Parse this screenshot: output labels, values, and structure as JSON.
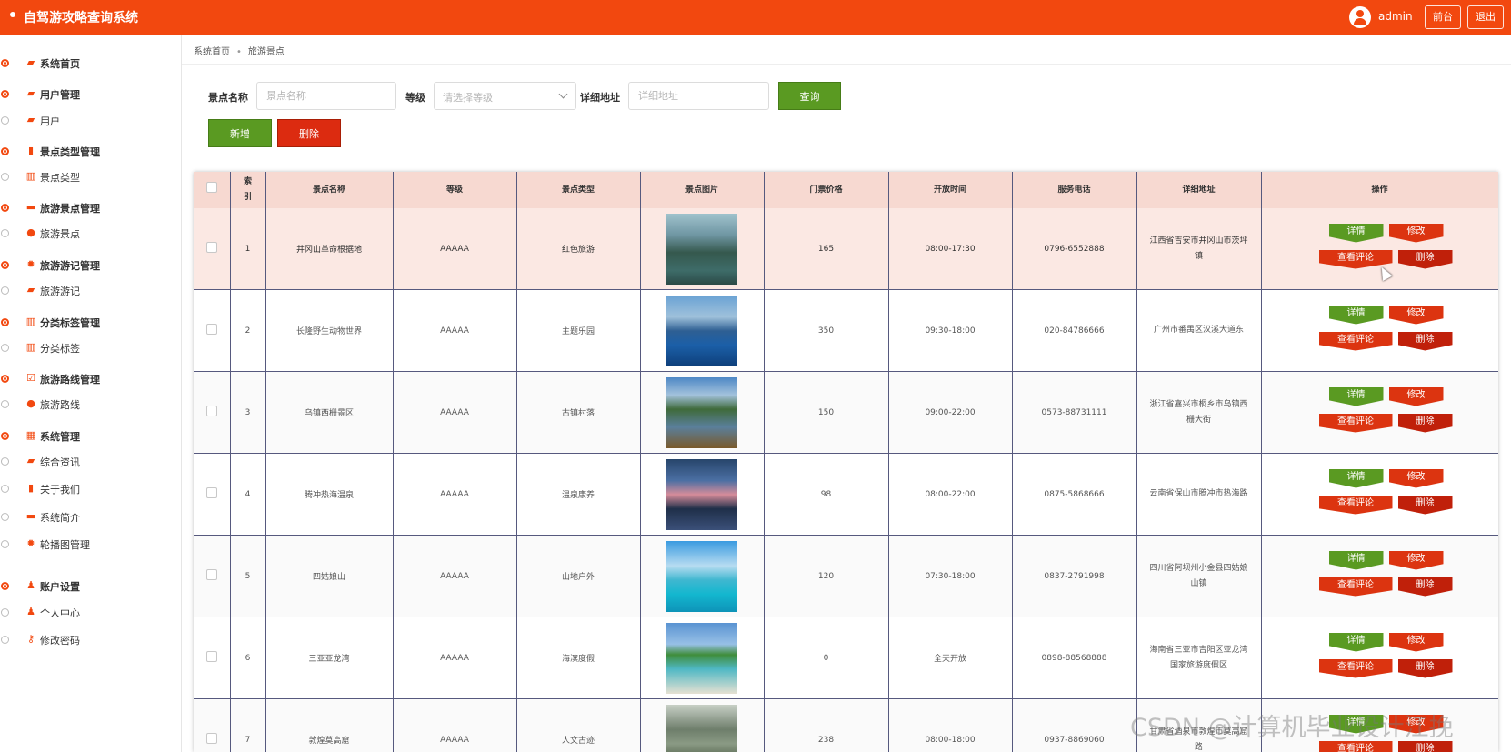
{
  "app": {
    "title": "自驾游攻略查询系统",
    "username": "admin",
    "btn_front": "前台",
    "btn_logout": "退出"
  },
  "sidebar": {
    "items": [
      {
        "label": "系统首页",
        "group": true,
        "icon": "briefcase-icon"
      },
      {
        "label": "用户管理",
        "group": true,
        "icon": "briefcase-icon"
      },
      {
        "label": "用户",
        "group": false,
        "icon": "briefcase-icon"
      },
      {
        "label": "景点类型管理",
        "group": true,
        "icon": "clipboard-icon"
      },
      {
        "label": "景点类型",
        "group": false,
        "icon": "bar-chart-icon"
      },
      {
        "label": "旅游景点管理",
        "group": true,
        "icon": "monitor-icon"
      },
      {
        "label": "旅游景点",
        "group": false,
        "icon": "map-pin-icon"
      },
      {
        "label": "旅游游记管理",
        "group": true,
        "icon": "gear-icon"
      },
      {
        "label": "旅游游记",
        "group": false,
        "icon": "briefcase-icon"
      },
      {
        "label": "分类标签管理",
        "group": true,
        "icon": "bar-chart-icon"
      },
      {
        "label": "分类标签",
        "group": false,
        "icon": "bar-chart-icon"
      },
      {
        "label": "旅游路线管理",
        "group": true,
        "icon": "checkbox-icon"
      },
      {
        "label": "旅游路线",
        "group": false,
        "icon": "map-pin-icon"
      },
      {
        "label": "系统管理",
        "group": true,
        "icon": "book-icon"
      },
      {
        "label": "综合资讯",
        "group": false,
        "icon": "briefcase-icon"
      },
      {
        "label": "关于我们",
        "group": false,
        "icon": "clipboard-icon"
      },
      {
        "label": "系统简介",
        "group": false,
        "icon": "monitor-icon"
      },
      {
        "label": "轮播图管理",
        "group": false,
        "icon": "gear-icon"
      },
      {
        "label": "账户设置",
        "group": true,
        "icon": "user-icon"
      },
      {
        "label": "个人中心",
        "group": false,
        "icon": "user-icon"
      },
      {
        "label": "修改密码",
        "group": false,
        "icon": "key-icon"
      }
    ]
  },
  "breadcrumb": {
    "home": "系统首页",
    "current": "旅游景点"
  },
  "filters": {
    "name_label": "景点名称",
    "name_placeholder": "景点名称",
    "level_label": "等级",
    "level_placeholder": "请选择等级",
    "addr_label": "详细地址",
    "addr_placeholder": "详细地址",
    "query_button": "查询"
  },
  "actions": {
    "add_button": "新增",
    "delete_button": "删除"
  },
  "table": {
    "headers": [
      "索引",
      "景点名称",
      "等级",
      "景点类型",
      "景点图片",
      "门票价格",
      "开放时间",
      "服务电话",
      "详细地址",
      "操作"
    ],
    "row_buttons": {
      "detail": "详情",
      "edit": "修改",
      "comments": "查看评论",
      "delete": "删除"
    },
    "rows": [
      {
        "index": "1",
        "name": "井冈山革命根据地",
        "level": "AAAAA",
        "type": "红色旅游",
        "image": "karst-mountains-river",
        "price": "165",
        "hours": "08:00-17:30",
        "phone": "0796-6552888",
        "address": "江西省吉安市井冈山市茨坪镇"
      },
      {
        "index": "2",
        "name": "长隆野生动物世界",
        "level": "AAAAA",
        "type": "主题乐园",
        "image": "lake-island-mountain",
        "price": "350",
        "hours": "09:30-18:00",
        "phone": "020-84786666",
        "address": "广州市番禺区汉溪大道东"
      },
      {
        "index": "3",
        "name": "乌镇西栅景区",
        "level": "AAAAA",
        "type": "古镇村落",
        "image": "lake-boats",
        "price": "150",
        "hours": "09:00-22:00",
        "phone": "0573-88731111",
        "address": "浙江省嘉兴市桐乡市乌镇西栅大街"
      },
      {
        "index": "4",
        "name": "腾冲热海温泉",
        "level": "AAAAA",
        "type": "温泉康养",
        "image": "sunset-lake",
        "price": "98",
        "hours": "08:00-22:00",
        "phone": "0875-5868666",
        "address": "云南省保山市腾冲市热海路"
      },
      {
        "index": "5",
        "name": "四姑娘山",
        "level": "AAAAA",
        "type": "山地户外",
        "image": "tropical-pool",
        "price": "120",
        "hours": "07:30-18:00",
        "phone": "0837-2791998",
        "address": "四川省阿坝州小金县四姑娘山镇"
      },
      {
        "index": "6",
        "name": "三亚亚龙湾",
        "level": "AAAAA",
        "type": "海滨度假",
        "image": "palm-beach",
        "price": "0",
        "hours": "全天开放",
        "phone": "0898-88568888",
        "address": "海南省三亚市吉阳区亚龙湾国家旅游度假区"
      },
      {
        "index": "7",
        "name": "敦煌莫高窟",
        "level": "AAAAA",
        "type": "人文古迹",
        "image": "rock-pillars",
        "price": "238",
        "hours": "08:00-18:00",
        "phone": "0937-8869060",
        "address": "甘肃省酒泉市敦煌市莫高窟路"
      }
    ]
  },
  "watermark": "CSDN @计算机毕业设计江挽",
  "colors": {
    "brand": "#f2480f",
    "green": "#5a9a22",
    "red": "#dc3410",
    "header_bg": "#f7d9d1",
    "grid_line": "#56597e"
  }
}
